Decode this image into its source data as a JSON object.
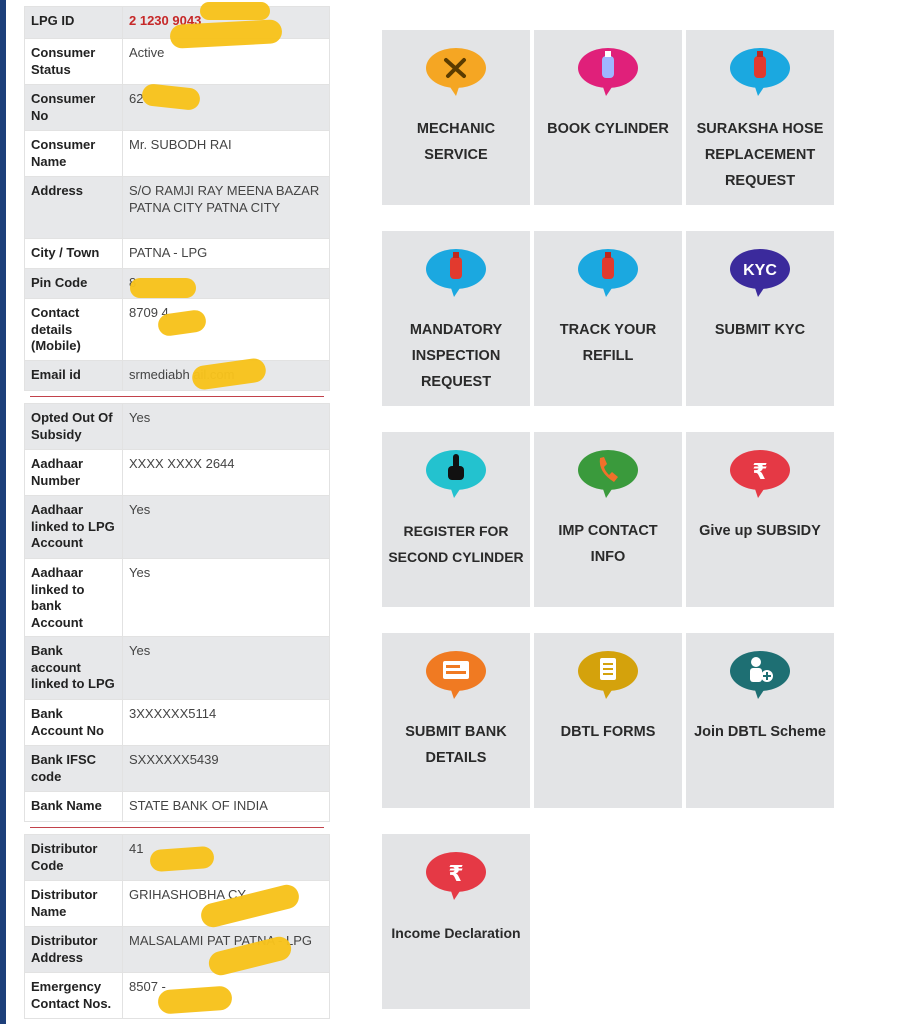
{
  "consumer": [
    {
      "label": "LPG ID",
      "value": "2 1230 9043"
    },
    {
      "label": "Consumer Status",
      "value": "Active"
    },
    {
      "label": "Consumer No",
      "value": "62"
    },
    {
      "label": "Consumer Name",
      "value": "Mr. SUBODH RAI"
    },
    {
      "label": "Address",
      "value": "S/O RAMJI RAY MEENA BAZAR PATNA CITY PATNA CITY"
    },
    {
      "label": "City / Town",
      "value": "PATNA - LPG"
    },
    {
      "label": "Pin Code",
      "value": "8"
    },
    {
      "label": "Contact details (Mobile)",
      "value": "8709 4"
    },
    {
      "label": "Email id",
      "value": "srmediabh ail.com"
    }
  ],
  "subsidy": [
    {
      "label": "Opted Out Of Subsidy",
      "value": "Yes"
    },
    {
      "label": "Aadhaar Number",
      "value": "XXXX XXXX 2644"
    },
    {
      "label": "Aadhaar linked to LPG Account",
      "value": "Yes"
    },
    {
      "label": "Aadhaar linked to bank Account",
      "value": "Yes"
    },
    {
      "label": "Bank account linked to LPG",
      "value": "Yes"
    },
    {
      "label": "Bank Account No",
      "value": "3XXXXXX5114"
    },
    {
      "label": "Bank IFSC code",
      "value": "SXXXXXX5439"
    },
    {
      "label": "Bank Name",
      "value": "STATE BANK OF INDIA"
    }
  ],
  "distributor": [
    {
      "label": "Distributor Code",
      "value": "41"
    },
    {
      "label": "Distributor Name",
      "value": "GRIHASHOBHA CY"
    },
    {
      "label": "Distributor Address",
      "value": "MALSALAMI PAT PATNA - LPG"
    },
    {
      "label": "Emergency Contact Nos.",
      "value": "8507 -"
    }
  ],
  "tiles": [
    {
      "label": "MECHANIC SERVICE",
      "icon": "tools-icon",
      "color": "#f5a623"
    },
    {
      "label": "BOOK CYLINDER",
      "icon": "cylinder-icon",
      "color": "#e0207a"
    },
    {
      "label": "SURAKSHA HOSE REPLACEMENT REQUEST",
      "icon": "cylinder-icon",
      "color": "#1ba8e0"
    },
    {
      "label": "MANDATORY INSPECTION REQUEST",
      "icon": "cylinder-icon",
      "color": "#1ba8e0"
    },
    {
      "label": "TRACK YOUR REFILL",
      "icon": "cylinder-icon",
      "color": "#1ba8e0"
    },
    {
      "label": "SUBMIT KYC",
      "icon": "kyc-icon",
      "color": "#3b2a9c"
    },
    {
      "label": "REGISTER FOR SECOND CYLINDER",
      "icon": "hand-pointer-icon",
      "color": "#23c2cf"
    },
    {
      "label": "IMP CONTACT INFO",
      "icon": "phone-icon",
      "color": "#3a9a3c"
    },
    {
      "label": "Give up SUBSIDY",
      "icon": "rupee-icon",
      "color": "#e53945"
    },
    {
      "label": "SUBMIT BANK DETAILS",
      "icon": "bank-cheque-icon",
      "color": "#f07a22"
    },
    {
      "label": "DBTL FORMS",
      "icon": "form-icon",
      "color": "#d4a20c"
    },
    {
      "label": "Join DBTL Scheme",
      "icon": "add-user-icon",
      "color": "#1e6f73"
    },
    {
      "label": "Income Declaration",
      "icon": "rupee-icon",
      "color": "#e53945"
    }
  ],
  "kyc_text": "KYC"
}
